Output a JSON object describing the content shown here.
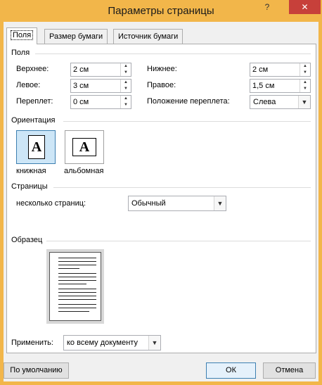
{
  "window": {
    "title": "Параметры страницы",
    "help_glyph": "?",
    "close_glyph": "✕"
  },
  "tabs": [
    "Поля",
    "Размер бумаги",
    "Источник бумаги"
  ],
  "margins": {
    "group_label": "Поля",
    "top_label": "Верхнее:",
    "top_value": "2 см",
    "bottom_label": "Нижнее:",
    "bottom_value": "2 см",
    "left_label": "Левое:",
    "left_value": "3 см",
    "right_label": "Правое:",
    "right_value": "1,5 см",
    "gutter_label": "Переплет:",
    "gutter_value": "0 см",
    "gutter_pos_label": "Положение переплета:",
    "gutter_pos_value": "Слева"
  },
  "orientation": {
    "group_label": "Ориентация",
    "portrait_label": "книжная",
    "landscape_label": "альбомная",
    "page_glyph": "A",
    "selected": "portrait"
  },
  "pages": {
    "group_label": "Страницы",
    "multiple_label": "несколько страниц:",
    "multiple_value": "Обычный"
  },
  "preview": {
    "group_label": "Образец"
  },
  "apply": {
    "label": "Применить:",
    "value": "ко всему документу"
  },
  "buttons": {
    "default": "По умолчанию",
    "ok": "ОК",
    "cancel": "Отмена"
  }
}
